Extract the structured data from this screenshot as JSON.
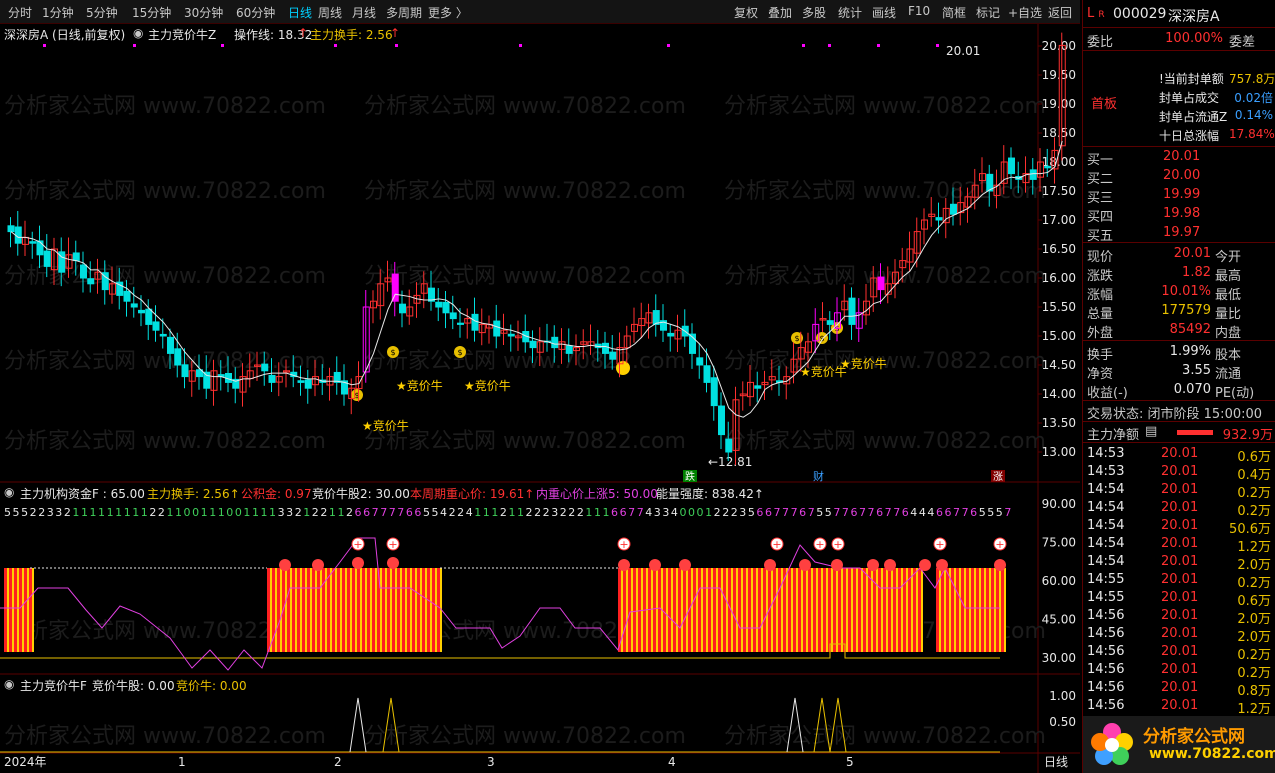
{
  "toolbar": {
    "periods": [
      "分时",
      "1分钟",
      "5分钟",
      "15分钟",
      "30分钟",
      "60分钟",
      "日线",
      "周线",
      "月线",
      "多周期",
      "更多 〉"
    ],
    "active_period": "日线",
    "tools": [
      "复权",
      "叠加",
      "多股",
      "统计",
      "画线",
      "F10",
      "简框",
      "标记",
      "+自选",
      "返回"
    ]
  },
  "main_header": {
    "stock": "深深房A (日线,前复权)",
    "indicator": "主力竞价牛Z",
    "op_label": "操作线: 18.32",
    "turnover_label": "主力换手: 2.56",
    "up_arrow": "↑"
  },
  "price_axis": [
    "20.00",
    "19.50",
    "19.00",
    "18.50",
    "18.00",
    "17.50",
    "17.00",
    "16.50",
    "16.00",
    "15.50",
    "15.00",
    "14.50",
    "14.00",
    "13.50",
    "13.00"
  ],
  "annotations": {
    "high": "20.01",
    "low": "←12.81",
    "signal": "★竞价牛",
    "die": "跌",
    "cai": "财",
    "zhang": "涨"
  },
  "watermark": "分析家公式网 www.70822.com",
  "panel2": {
    "title": "主力机构资金F : 65.00",
    "items": [
      {
        "t": "主力换手: 2.56↑",
        "c": "#e8c000"
      },
      {
        "t": "公积金: 0.97",
        "c": "#ff3030"
      },
      {
        "t": "竞价牛股2: 30.00",
        "c": "#e8e8e8"
      },
      {
        "t": "本周期重心价: 19.61↑",
        "c": "#ff3030"
      },
      {
        "t": "内重心价上涨5: 50.00",
        "c": "#e040e0"
      },
      {
        "t": "能量强度: 838.42↑",
        "c": "#e8e8e8"
      }
    ],
    "digits": "5552233211111111122110011100111133212211266777766554224111211222322211166774334000122235667776755776776776444667765557",
    "axis": [
      "90.00",
      "75.00",
      "60.00",
      "45.00",
      "30.00"
    ]
  },
  "panel3": {
    "title": "主力竞价牛F",
    "item1": "竞价牛股: 0.00",
    "item2": "竞价牛: 0.00",
    "axis": [
      "1.00",
      "0.50"
    ]
  },
  "date_axis": [
    "2024年",
    "1",
    "2",
    "3",
    "4",
    "5"
  ],
  "date_axis_right": "日线",
  "right": {
    "code": "000029",
    "name": "深深房A",
    "weibi_label": "委比",
    "weibi_value": "100.00%",
    "weicha_label": "委差",
    "board_label": "首板",
    "seal_rows": [
      {
        "label": "!当前封单额",
        "value": "757.8万",
        "color": "#e8c000"
      },
      {
        "label": "封单占成交",
        "value": "0.02倍",
        "color": "#3a9fff"
      },
      {
        "label": "封单占流通Z",
        "value": "0.14%",
        "color": "#3a9fff"
      },
      {
        "label": "十日总涨幅",
        "value": "17.84%",
        "color": "#ff3030"
      }
    ],
    "buys": [
      {
        "label": "买一",
        "price": "20.01",
        "vol": ""
      },
      {
        "label": "买二",
        "price": "20.00",
        "vol": ""
      },
      {
        "label": "买三",
        "price": "19.99",
        "vol": ""
      },
      {
        "label": "买四",
        "price": "19.98",
        "vol": ""
      },
      {
        "label": "买五",
        "price": "19.97",
        "vol": ""
      }
    ],
    "stats": [
      {
        "l": "现价",
        "v": "20.01",
        "vc": "#ff3030",
        "r": "今开"
      },
      {
        "l": "涨跌",
        "v": "1.82",
        "vc": "#ff3030",
        "r": "最高"
      },
      {
        "l": "涨幅",
        "v": "10.01%",
        "vc": "#ff3030",
        "r": "最低"
      },
      {
        "l": "总量",
        "v": "177579",
        "vc": "#e8c000",
        "r": "量比"
      },
      {
        "l": "外盘",
        "v": "85492",
        "vc": "#ff3030",
        "r": "内盘"
      }
    ],
    "stats2": [
      {
        "l": "换手",
        "v": "1.99%",
        "r": "股本"
      },
      {
        "l": "净资",
        "v": "3.55",
        "r": "流通"
      },
      {
        "l": "收益(-)",
        "v": "0.070",
        "r": "PE(动)"
      }
    ],
    "trade_status": "交易状态: 闭市阶段 15:00:00",
    "net_label": "主力净额",
    "net_value": "932.9万",
    "ticks": [
      {
        "t": "14:53",
        "p": "20.01",
        "v": "0.6万"
      },
      {
        "t": "14:53",
        "p": "20.01",
        "v": "0.4万"
      },
      {
        "t": "14:54",
        "p": "20.01",
        "v": "0.2万"
      },
      {
        "t": "14:54",
        "p": "20.01",
        "v": "0.2万"
      },
      {
        "t": "14:54",
        "p": "20.01",
        "v": "50.6万"
      },
      {
        "t": "14:54",
        "p": "20.01",
        "v": "1.2万"
      },
      {
        "t": "14:54",
        "p": "20.01",
        "v": "2.0万"
      },
      {
        "t": "14:55",
        "p": "20.01",
        "v": "0.2万"
      },
      {
        "t": "14:55",
        "p": "20.01",
        "v": "0.6万"
      },
      {
        "t": "14:56",
        "p": "20.01",
        "v": "2.0万"
      },
      {
        "t": "14:56",
        "p": "20.01",
        "v": "2.0万"
      },
      {
        "t": "14:56",
        "p": "20.01",
        "v": "0.2万"
      },
      {
        "t": "14:56",
        "p": "20.01",
        "v": "0.2万"
      },
      {
        "t": "14:56",
        "p": "20.01",
        "v": "0.8万"
      },
      {
        "t": "14:56",
        "p": "20.01",
        "v": "1.2万"
      }
    ],
    "logo_text": "分析家公式网",
    "logo_url": "www.70822.com"
  },
  "colors": {
    "up": "#ff3030",
    "down": "#00e0e0",
    "yellow": "#e8c000",
    "magenta": "#ff00ff"
  }
}
